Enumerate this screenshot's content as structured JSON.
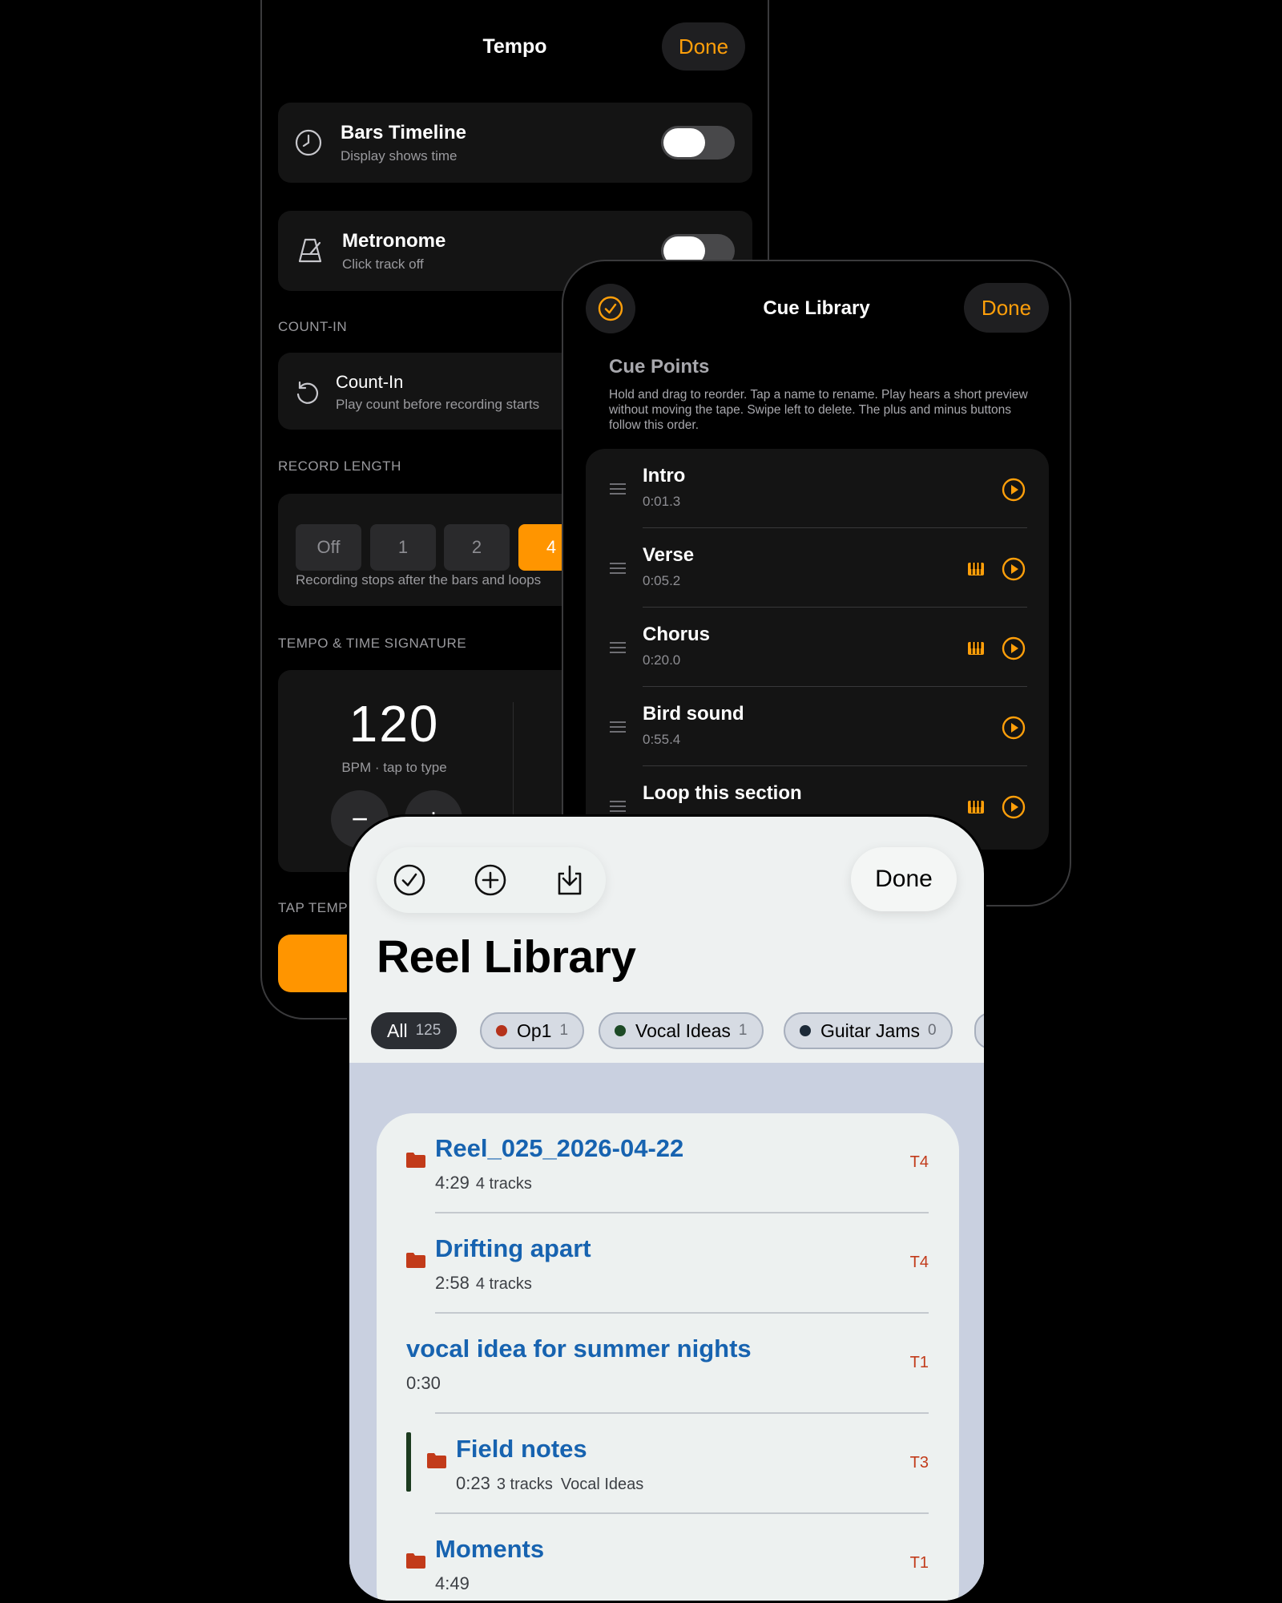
{
  "tempo": {
    "title": "Tempo",
    "done_label": "Done",
    "bars_timeline": {
      "title": "Bars Timeline",
      "subtitle": "Display shows time",
      "on": false
    },
    "metronome": {
      "title": "Metronome",
      "subtitle": "Click track off",
      "on": false
    },
    "count_in_section": "COUNT-IN",
    "count_in": {
      "title": "Count-In",
      "subtitle": "Play count before recording starts"
    },
    "record_length_section": "RECORD LENGTH",
    "record_length": {
      "options": [
        "Off",
        "1",
        "2",
        "4"
      ],
      "selected": "4",
      "note": "Recording stops after the bars and loops"
    },
    "tempo_section": "TEMPO & TIME SIGNATURE",
    "bpm": {
      "value": "120",
      "caption": "BPM · tap to type",
      "minus": "−",
      "plus": "+"
    },
    "tap_section": "TAP TEMP"
  },
  "cue": {
    "title": "Cue Library",
    "done_label": "Done",
    "heading": "Cue Points",
    "description": "Hold and drag to reorder. Tap a name to rename. Play hears a short preview without moving the tape. Swipe left to delete. The plus and minus buttons follow this order.",
    "items": [
      {
        "name": "Intro",
        "time": "0:01.3",
        "keys": false
      },
      {
        "name": "Verse",
        "time": "0:05.2",
        "keys": true
      },
      {
        "name": "Chorus",
        "time": "0:20.0",
        "keys": true
      },
      {
        "name": "Bird sound",
        "time": "0:55.4",
        "keys": false
      },
      {
        "name": "Loop this section",
        "time": "",
        "keys": true
      }
    ],
    "accent_color": "#ff9f0a"
  },
  "reel": {
    "title": "Reel Library",
    "done_label": "Done",
    "toolbar_icons": [
      "check-circle-icon",
      "plus-circle-icon",
      "download-icon"
    ],
    "chips": [
      {
        "label": "All",
        "count": "125",
        "active": true
      },
      {
        "label": "Op1",
        "count": "1",
        "dot": "#b5321b"
      },
      {
        "label": "Vocal Ideas",
        "count": "1",
        "dot": "#1d4a26"
      },
      {
        "label": "Guitar Jams",
        "count": "0",
        "dot": "#1d2a38"
      }
    ],
    "items": [
      {
        "name": "Reel_025_2026-04-22",
        "duration": "4:29",
        "tracks": "4 tracks",
        "tag": "",
        "take": "T4",
        "folder": true
      },
      {
        "name": "Drifting apart",
        "duration": "2:58",
        "tracks": "4 tracks",
        "tag": "",
        "take": "T4",
        "folder": true
      },
      {
        "name": "vocal idea for summer nights",
        "duration": "0:30",
        "tracks": "",
        "tag": "",
        "take": "T1",
        "folder": false
      },
      {
        "name": "Field notes",
        "duration": "0:23",
        "tracks": "3 tracks",
        "tag": "Vocal Ideas",
        "take": "T3",
        "folder": true
      },
      {
        "name": "Moments",
        "duration": "4:49",
        "tracks": "",
        "tag": "",
        "take": "T1",
        "folder": true
      }
    ]
  }
}
